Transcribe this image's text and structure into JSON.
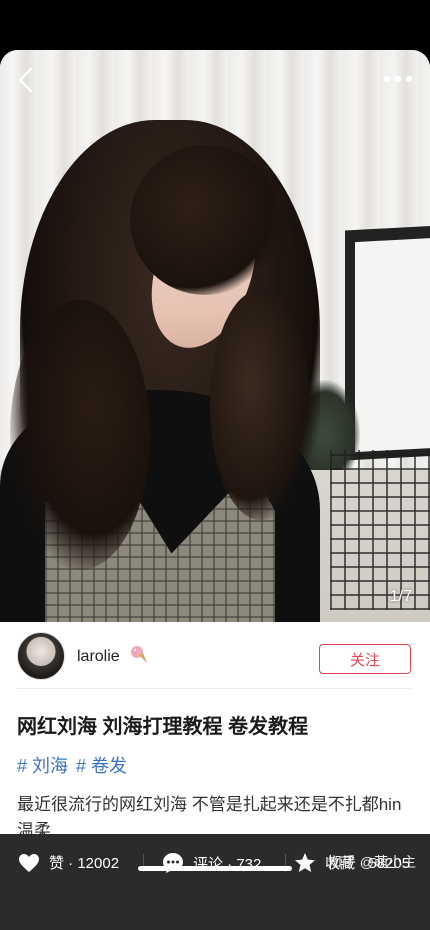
{
  "photo": {
    "page_counter": "1/7"
  },
  "topbar": {
    "back_icon": "chevron-left-icon",
    "more_icon": "more-dots-icon"
  },
  "author": {
    "username": "larolie",
    "emoji_icon": "ice-cream-icon",
    "follow_label": "关注"
  },
  "post": {
    "title": "网红刘海 刘海打理教程 卷发教程",
    "tags": [
      "# 刘海",
      "# 卷发"
    ],
    "body": "最近很流行的网红刘海 不管是扎起来还是不扎都hin温柔"
  },
  "actions": {
    "like": {
      "label": "赞 · 12002",
      "icon": "heart-icon"
    },
    "comment": {
      "label": "评论 · 732",
      "icon": "comment-bubble-icon"
    },
    "favorite": {
      "label": "收藏 · 58205",
      "icon": "star-icon"
    }
  },
  "watermark": "知乎 @萌小主",
  "colors": {
    "accent": "#e34850",
    "tag": "#3b73c4",
    "action_bar": "#2b2b2b"
  }
}
